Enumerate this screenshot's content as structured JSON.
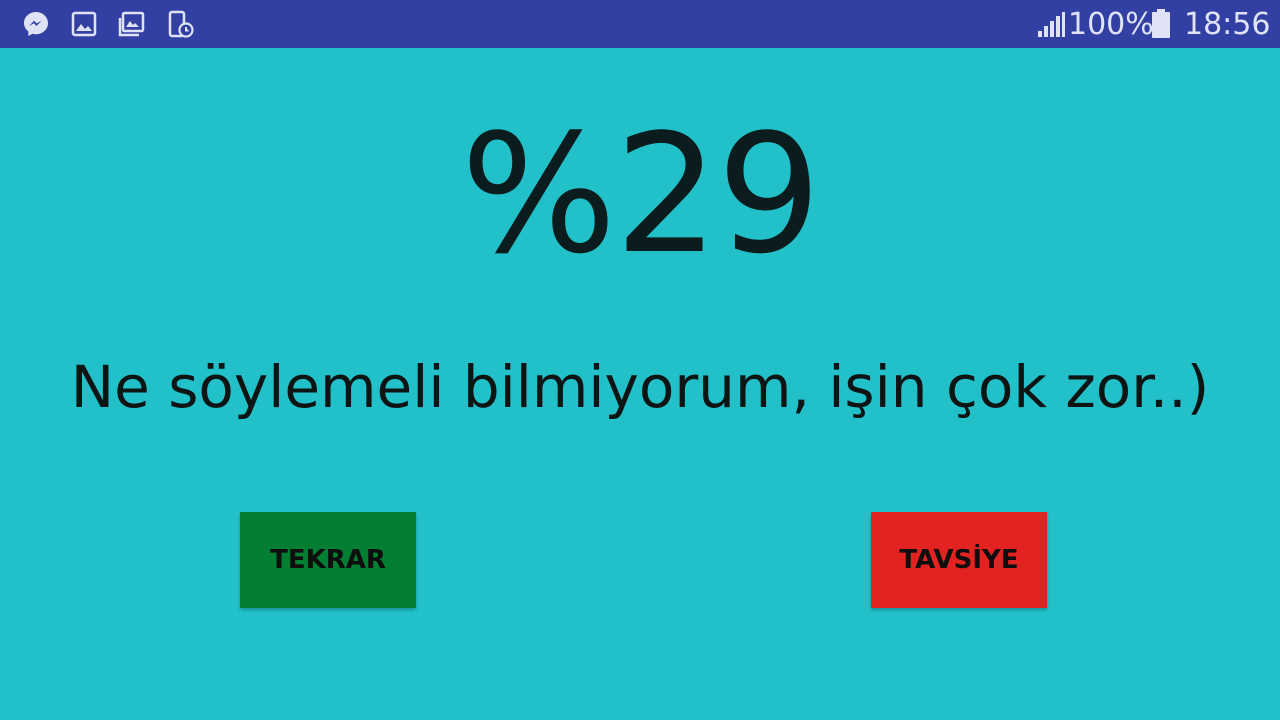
{
  "status_bar": {
    "left_icons": [
      "messenger-icon",
      "gallery-icon",
      "photo-album-icon",
      "device-schedule-icon"
    ],
    "signal_icon": "signal-icon",
    "battery_text": "100%",
    "battery_icon": "battery-icon",
    "time": "18:56"
  },
  "result": {
    "score": "%29",
    "message": "Ne söylemeli bilmiyorum, işin çok zor..)"
  },
  "buttons": {
    "retry_label": "TEKRAR",
    "advice_label": "TAVSİYE"
  },
  "colors": {
    "background": "#22c1c9",
    "status_bar": "#3340a3",
    "retry_button": "#027f32",
    "advice_button": "#e32222"
  }
}
